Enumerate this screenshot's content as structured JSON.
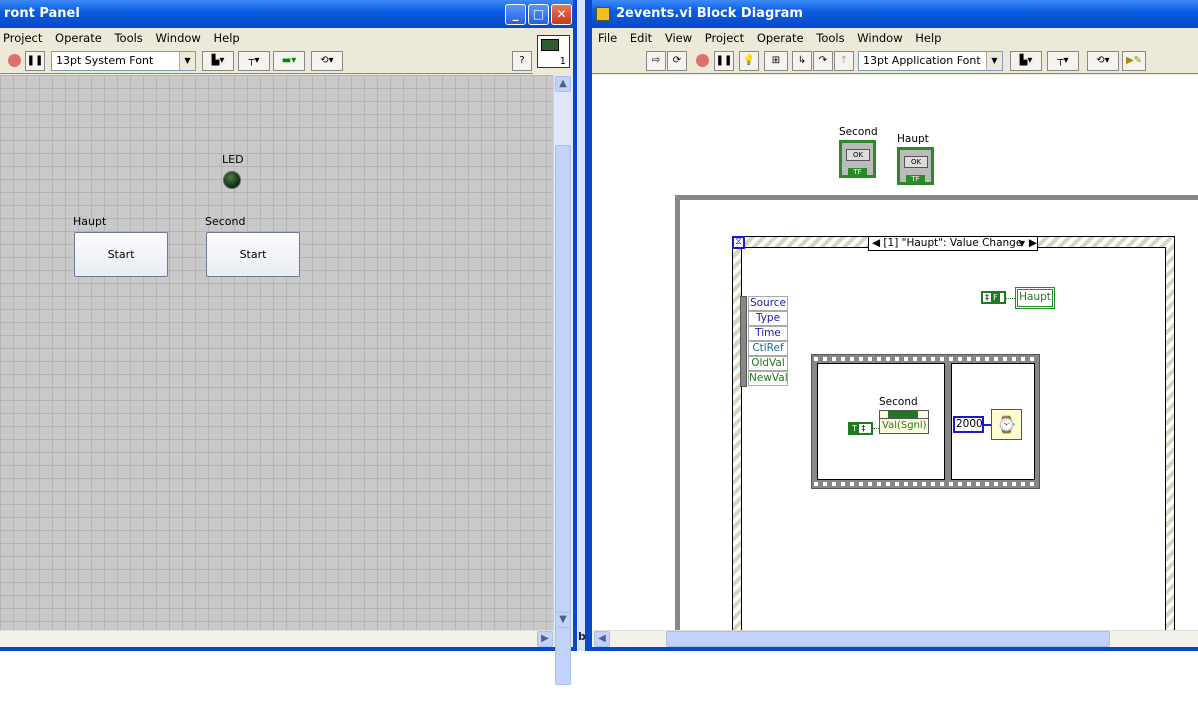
{
  "front_panel": {
    "title": "ront Panel",
    "menu": [
      "Project",
      "Operate",
      "Tools",
      "Window",
      "Help"
    ],
    "font": "13pt System Font",
    "led_label": "LED",
    "controls": [
      {
        "label": "Haupt",
        "button_text": "Start"
      },
      {
        "label": "Second",
        "button_text": "Start"
      }
    ],
    "vi_icon_number": "1"
  },
  "taskbar_fragment": "b",
  "block_diagram": {
    "title": "2events.vi Block Diagram",
    "menu": [
      "File",
      "Edit",
      "View",
      "Project",
      "Operate",
      "Tools",
      "Window",
      "Help"
    ],
    "font": "13pt Application Font",
    "terminals": [
      {
        "label": "Second",
        "text": "OK",
        "type": "TF"
      },
      {
        "label": "Haupt",
        "text": "OK",
        "type": "TF"
      }
    ],
    "event_case": "[1] \"Haupt\": Value Change",
    "event_data": [
      "Source",
      "Type",
      "Time",
      "CtlRef",
      "OldVal",
      "NewVal"
    ],
    "false_const": "F",
    "true_const": "T",
    "haupt_local": "Haupt",
    "property_node_label": "Second",
    "property_node_item": "Val(Sgnl)",
    "wait_ms": "2000"
  },
  "colors": {
    "titlebar": "#0a5ee0",
    "bool_wire": "#1f7a1f",
    "numeric": "#1a1ac8",
    "event_data_text": "#1a1aa8"
  }
}
